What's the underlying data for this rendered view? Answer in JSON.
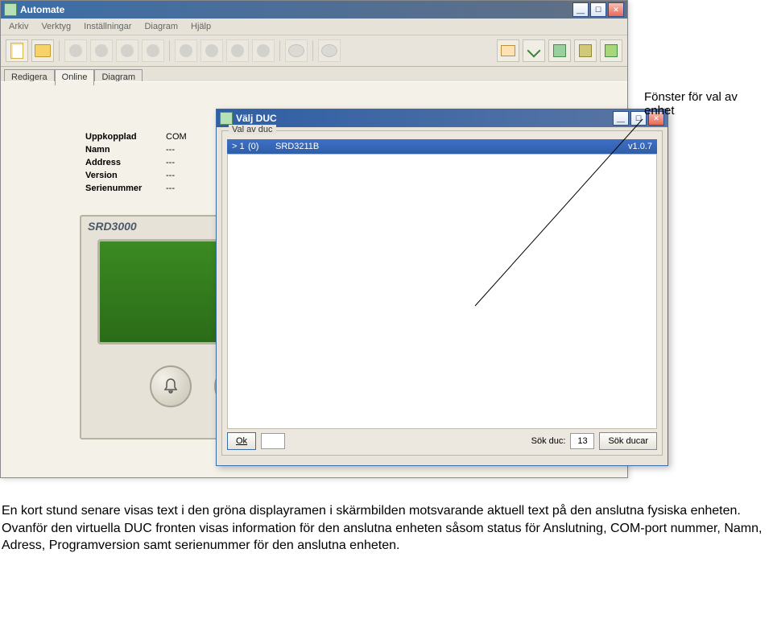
{
  "app": {
    "title": "Automate",
    "menu": [
      "Arkiv",
      "Verktyg",
      "Inställningar",
      "Diagram",
      "Hjälp"
    ],
    "tabs": [
      "Redigera",
      "Online",
      "Diagram"
    ],
    "active_tab": 1
  },
  "status": {
    "rows": [
      {
        "label": "Uppkopplad",
        "value": "COM"
      },
      {
        "label": "Namn",
        "value": "---"
      },
      {
        "label": "Address",
        "value": "---"
      },
      {
        "label": "Version",
        "value": "---"
      },
      {
        "label": "Serienummer",
        "value": "---"
      }
    ]
  },
  "device": {
    "model": "SRD3000"
  },
  "dialog": {
    "title": "Välj DUC",
    "group": "Val av duc",
    "row": {
      "idx": "> 1",
      "paren": "(0)",
      "name": "SRD3211B",
      "ver": "v1.0.7"
    },
    "ok": "Ok",
    "search_label": "Sök duc:",
    "search_value": "13",
    "search_btn": "Sök ducar"
  },
  "callout": "Fönster för val av enhet",
  "paragraph": "En kort stund senare visas text i den gröna displayramen i skärmbilden motsvarande aktuell text på den anslutna fysiska enheten. Ovanför den virtuella DUC fronten visas information för den anslutna enheten såsom status för Anslutning, COM-port nummer, Namn, Adress, Programversion samt serienummer för den anslutna enheten."
}
